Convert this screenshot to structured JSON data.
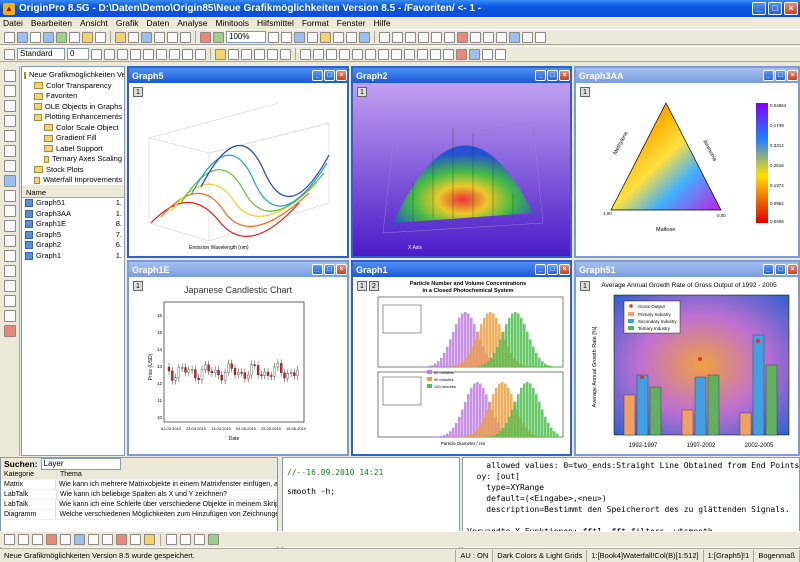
{
  "app": {
    "title": "OriginPro 8.5G - D:\\Daten\\Demo\\Origin85\\Neue Grafikmöglichkeiten Version 8.5 - /Favoriten/ <- 1 -"
  },
  "menu": [
    "Datei",
    "Bearbeiten",
    "Ansicht",
    "Grafik",
    "Daten",
    "Analyse",
    "Minitools",
    "Hilfsmittel",
    "Format",
    "Fenster",
    "Hilfe"
  ],
  "toolbar": {
    "zoom": "100%",
    "font": "Standard",
    "size": "0"
  },
  "tree": {
    "root": "Neue Grafikmöglichkeiten Versio",
    "items": [
      "Color Transparency",
      "Favoriten",
      "OLE Objects in Graphs",
      "Plotting Enhancements",
      "Color Scale Object",
      "Gradient Fill",
      "Label Support",
      "Ternary Axes Scaling",
      "Stock Plots",
      "Waterfall Improvements"
    ]
  },
  "list": {
    "header_name": "Name",
    "rows": [
      {
        "name": "Graph51",
        "n": "1."
      },
      {
        "name": "Graph3AA",
        "n": "1."
      },
      {
        "name": "Graph1E",
        "n": "8."
      },
      {
        "name": "Graph5",
        "n": "7."
      },
      {
        "name": "Graph2",
        "n": "6."
      },
      {
        "name": "Graph1",
        "n": "1."
      }
    ]
  },
  "windows": {
    "g5": "Graph5",
    "g2": "Graph2",
    "g3aa": "Graph3AA",
    "g1e": "Graph1E",
    "g1": "Graph1",
    "g51": "Graph51"
  },
  "layer_label": "1",
  "layer_label2": "2",
  "g5_xlabel": "Emission Wavelength (nm)",
  "g2_axis": "X Axis",
  "g3aa": {
    "left": "Methylene",
    "right": "Ammonia",
    "bottom": "Maltose",
    "scale": [
      "0,04664",
      "0,1749",
      "0,3314",
      "0,2516",
      "0,1374",
      "0,0962",
      "0,0406"
    ],
    "ticks": [
      "0,00",
      "1,00"
    ]
  },
  "g1e": {
    "title": "Japanese Candlestic Chart",
    "ylabel": "Price (USD)",
    "xlabel": "Date",
    "xticks": [
      "02.03.2010",
      "23.03.2010",
      "13.04.2010",
      "04.05.2010",
      "25.05.2010",
      "15.06.2010"
    ],
    "yticks": [
      "16",
      "15",
      "14",
      "13",
      "12",
      "11",
      "10"
    ]
  },
  "g1": {
    "title": "Particle Number and Volume Concentrations",
    "subtitle": "in a Closed Photochemical System",
    "xlabel": "Particle Diameter / nm",
    "legend": [
      "60 minutes",
      "90 minutes",
      "120 minutes"
    ]
  },
  "g51": {
    "title": "Average Annual Growth Rate of Gross Output of 1992 - 2005",
    "ylabel": "Average Annual Growth Rate [%]",
    "categories": [
      "1992-1997",
      "1997-2002",
      "2002-2005"
    ],
    "legend": [
      "Gross Output",
      "Primary Industry",
      "Secondary Industry",
      "Tertiary Industry"
    ]
  },
  "search": {
    "label": "Suchen:",
    "value": "Layer",
    "col1": "Kategorie",
    "col2": "Thema",
    "rows": [
      {
        "k": "Matrix",
        "t": "Wie kann ich mehrere Matrixobjekte in einem Matrixfenster einfügen, an"
      },
      {
        "k": "LabTalk",
        "t": "Wie kann ich beliebige Spalten als X und Y zeichnen?"
      },
      {
        "k": "LabTalk",
        "t": "Wie kann ich eine Schleife über verschiedene Objekte in meinem Skript"
      },
      {
        "k": "Diagramm",
        "t": "Welche verschiedenen Möglichkeiten zum Hinzufügen von Zeichnunge"
      }
    ]
  },
  "cmd": {
    "line1": "//--16.09.2010 14:21",
    "line2": "smooth -h;"
  },
  "help": "    allowed values: 0=two_ends:Straight Line Obtained from End Points,\n  oy: [out]\n    type=XYRange\n    default=(<Eingabe>,<neu>)\n    description=Bestimmt den Speicherort des zu glättenden Signals.\n\nVerwandte X-Funktionen: fft1, fft_filters, wtsmooth\n%%\n>>",
  "status": {
    "msg": "Neue Grafikmöglichkeiten Version 8.5 wurde gespeichert.",
    "au": "AU : ON",
    "theme": "Dark Colors & Light Grids",
    "book": "1:[Book4]Waterfall!Col(B)[1:512]",
    "graph": "1:[Graph5]!1",
    "unit": "Bogenmaß"
  }
}
